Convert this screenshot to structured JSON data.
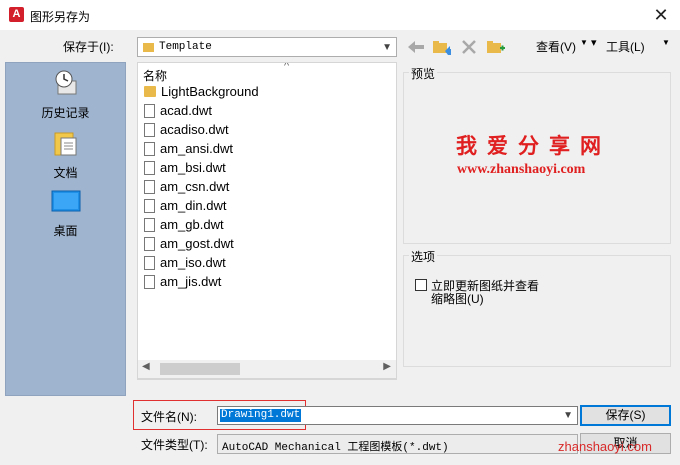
{
  "titlebar": {
    "title": "图形另存为",
    "app_icon_letter": "A"
  },
  "toolbar": {
    "save_in_label": "保存于(I):",
    "current_folder": "Template",
    "view_label": "查看(V)",
    "tools_label": "工具(L)"
  },
  "places": [
    {
      "label": "历史记录",
      "icon": "history-icon"
    },
    {
      "label": "文档",
      "icon": "documents-icon"
    },
    {
      "label": "桌面",
      "icon": "desktop-icon"
    }
  ],
  "file_list": {
    "column_header": "名称",
    "items": [
      {
        "name": "LightBackground",
        "type": "folder"
      },
      {
        "name": "acad.dwt",
        "type": "file"
      },
      {
        "name": "acadiso.dwt",
        "type": "file"
      },
      {
        "name": "am_ansi.dwt",
        "type": "file"
      },
      {
        "name": "am_bsi.dwt",
        "type": "file"
      },
      {
        "name": "am_csn.dwt",
        "type": "file"
      },
      {
        "name": "am_din.dwt",
        "type": "file"
      },
      {
        "name": "am_gb.dwt",
        "type": "file"
      },
      {
        "name": "am_gost.dwt",
        "type": "file"
      },
      {
        "name": "am_iso.dwt",
        "type": "file"
      },
      {
        "name": "am_jis.dwt",
        "type": "file"
      }
    ]
  },
  "preview": {
    "label": "预览",
    "watermark_title": "我爱分享网",
    "watermark_url": "www.zhanshaoyi.com"
  },
  "options": {
    "label": "选项",
    "checkbox_label_line1": "立即更新图纸并查看",
    "checkbox_label_line2": "缩略图(U)",
    "checked": false
  },
  "bottom": {
    "filename_label": "文件名(N):",
    "filename_value": "Drawing1.dwt",
    "filetype_label": "文件类型(T):",
    "filetype_value": "AutoCAD Mechanical 工程图模板(*.dwt)",
    "save_button": "保存(S)",
    "cancel_button": "取消"
  },
  "corner_watermark": "zhanshaoyi.com",
  "colors": {
    "accent": "#0078d7",
    "watermark_red": "#e02020",
    "places_bg": "#9fb4cf"
  }
}
